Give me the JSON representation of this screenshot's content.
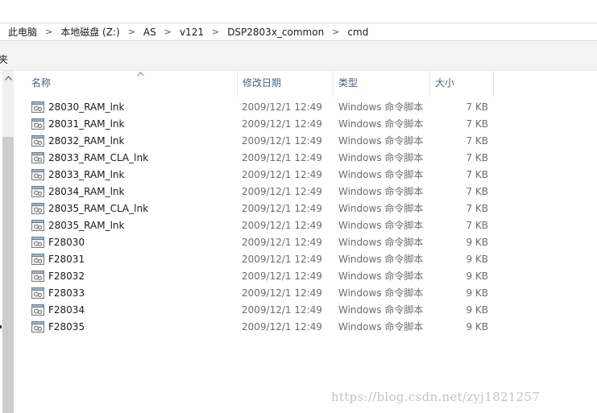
{
  "breadcrumb": {
    "items": [
      "此电脑",
      "本地磁盘 (Z:)",
      "AS",
      "v121",
      "DSP2803x_common",
      "cmd"
    ],
    "separator": ">"
  },
  "command_bar": {
    "partial_label": "夹"
  },
  "columns": {
    "name": "名称",
    "date": "修改日期",
    "type": "类型",
    "size": "大小"
  },
  "files": [
    {
      "name": "28030_RAM_lnk",
      "date": "2009/12/1 12:49",
      "type": "Windows 命令脚本",
      "size": "7 KB"
    },
    {
      "name": "28031_RAM_lnk",
      "date": "2009/12/1 12:49",
      "type": "Windows 命令脚本",
      "size": "7 KB"
    },
    {
      "name": "28032_RAM_lnk",
      "date": "2009/12/1 12:49",
      "type": "Windows 命令脚本",
      "size": "7 KB"
    },
    {
      "name": "28033_RAM_CLA_lnk",
      "date": "2009/12/1 12:49",
      "type": "Windows 命令脚本",
      "size": "7 KB"
    },
    {
      "name": "28033_RAM_lnk",
      "date": "2009/12/1 12:49",
      "type": "Windows 命令脚本",
      "size": "7 KB"
    },
    {
      "name": "28034_RAM_lnk",
      "date": "2009/12/1 12:49",
      "type": "Windows 命令脚本",
      "size": "7 KB"
    },
    {
      "name": "28035_RAM_CLA_lnk",
      "date": "2009/12/1 12:49",
      "type": "Windows 命令脚本",
      "size": "7 KB"
    },
    {
      "name": "28035_RAM_lnk",
      "date": "2009/12/1 12:49",
      "type": "Windows 命令脚本",
      "size": "7 KB"
    },
    {
      "name": "F28030",
      "date": "2009/12/1 12:49",
      "type": "Windows 命令脚本",
      "size": "9 KB"
    },
    {
      "name": "F28031",
      "date": "2009/12/1 12:49",
      "type": "Windows 命令脚本",
      "size": "9 KB"
    },
    {
      "name": "F28032",
      "date": "2009/12/1 12:49",
      "type": "Windows 命令脚本",
      "size": "9 KB"
    },
    {
      "name": "F28033",
      "date": "2009/12/1 12:49",
      "type": "Windows 命令脚本",
      "size": "9 KB"
    },
    {
      "name": "F28034",
      "date": "2009/12/1 12:49",
      "type": "Windows 命令脚本",
      "size": "9 KB"
    },
    {
      "name": "F28035",
      "date": "2009/12/1 12:49",
      "type": "Windows 命令脚本",
      "size": "9 KB"
    }
  ],
  "watermark": "https://blog.csdn.net/zyj1821257",
  "icons": {
    "file": "cmd-script-file-icon",
    "sort": "sort-ascending-caret-icon",
    "scroll_up": "scroll-up-arrow-icon"
  },
  "colors": {
    "header_text": "#4c607a",
    "secondary_text": "#6d6d6d",
    "scroll_thumb": "#cdcdcd",
    "command_bar_bg": "#f3f3f3"
  }
}
